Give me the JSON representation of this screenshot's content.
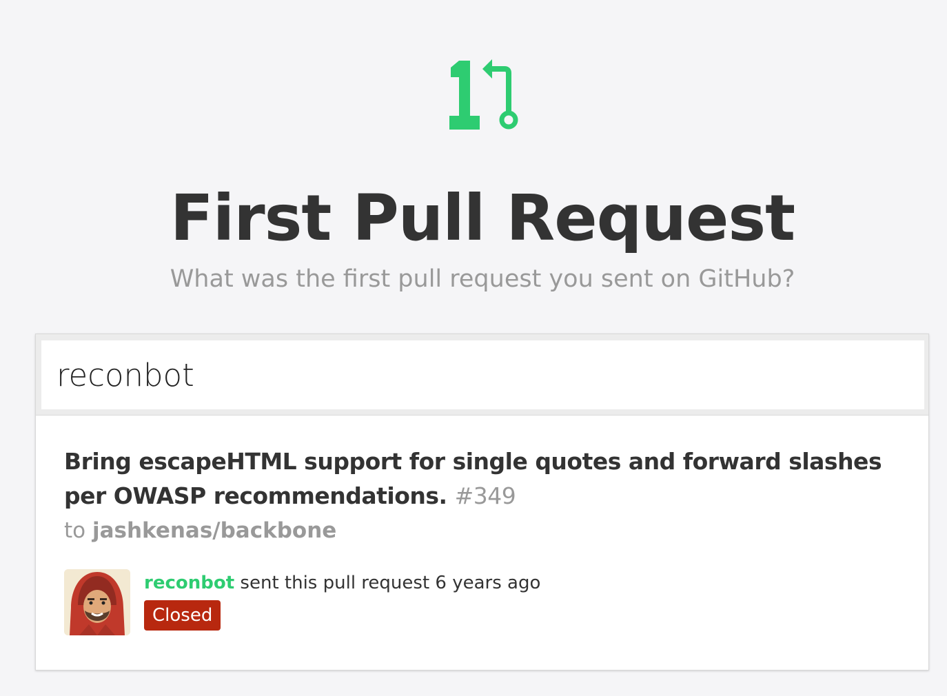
{
  "header": {
    "title": "First Pull Request",
    "subtitle": "What was the first pull request you sent on GitHub?",
    "logo_icon": "pull-request-icon",
    "brand_color": "#2ecc71"
  },
  "search": {
    "value": "reconbot"
  },
  "result": {
    "pr_title": "Bring escapeHTML support for single quotes and forward slashes per OWASP recommendations.",
    "pr_number": "#349",
    "repo_prefix": "to",
    "repo": "jashkenas/backbone",
    "username": "reconbot",
    "sent_text": "sent this pull request 6 years ago",
    "status": "Closed",
    "status_color": "#b8280f"
  }
}
